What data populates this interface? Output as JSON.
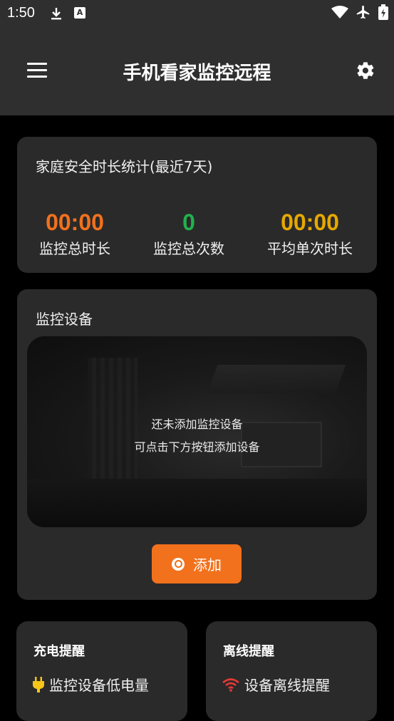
{
  "status_bar": {
    "time": "1:50"
  },
  "app_bar": {
    "title": "手机看家监控远程"
  },
  "stats_card": {
    "title": "家庭安全时长统计(最近7天)",
    "items": [
      {
        "value": "00:00",
        "label": "监控总时长",
        "color": "#f2711c"
      },
      {
        "value": "0",
        "label": "监控总次数",
        "color": "#22b14c"
      },
      {
        "value": "00:00",
        "label": "平均单次时长",
        "color": "#e6a800"
      }
    ]
  },
  "devices_card": {
    "title": "监控设备",
    "empty_line1": "还未添加监控设备",
    "empty_line2": "可点击下方按钮添加设备",
    "add_label": "添加",
    "accent": "#f2711c"
  },
  "reminders": {
    "charge": {
      "title": "充电提醒",
      "text": "监控设备低电量",
      "icon": "plug-icon",
      "icon_color": "#f5c518"
    },
    "offline": {
      "title": "离线提醒",
      "text": "设备离线提醒",
      "icon": "wifi-icon",
      "icon_color": "#e53935"
    }
  }
}
